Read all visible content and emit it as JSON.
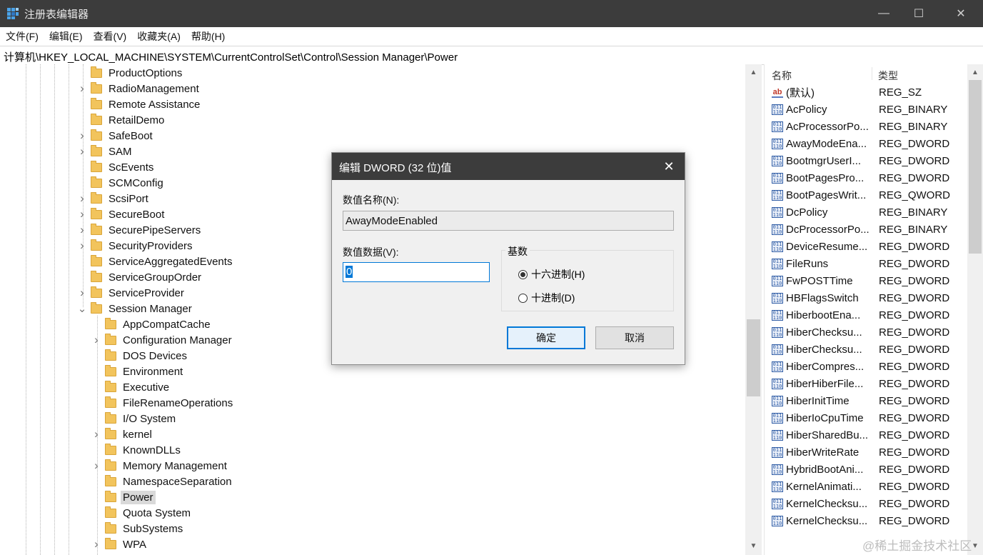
{
  "window": {
    "title": "注册表编辑器",
    "minimize": "—",
    "maximize": "☐",
    "close": "✕"
  },
  "menu": [
    "文件(F)",
    "编辑(E)",
    "查看(V)",
    "收藏夹(A)",
    "帮助(H)"
  ],
  "address": "计算机\\HKEY_LOCAL_MACHINE\\SYSTEM\\CurrentControlSet\\Control\\Session Manager\\Power",
  "tree": {
    "items": [
      {
        "label": "ProductOptions",
        "level": 1,
        "expander": ""
      },
      {
        "label": "RadioManagement",
        "level": 1,
        "expander": "collapsed"
      },
      {
        "label": "Remote Assistance",
        "level": 1,
        "expander": ""
      },
      {
        "label": "RetailDemo",
        "level": 1,
        "expander": ""
      },
      {
        "label": "SafeBoot",
        "level": 1,
        "expander": "collapsed"
      },
      {
        "label": "SAM",
        "level": 1,
        "expander": "collapsed"
      },
      {
        "label": "ScEvents",
        "level": 1,
        "expander": ""
      },
      {
        "label": "SCMConfig",
        "level": 1,
        "expander": ""
      },
      {
        "label": "ScsiPort",
        "level": 1,
        "expander": "collapsed"
      },
      {
        "label": "SecureBoot",
        "level": 1,
        "expander": "collapsed"
      },
      {
        "label": "SecurePipeServers",
        "level": 1,
        "expander": "collapsed"
      },
      {
        "label": "SecurityProviders",
        "level": 1,
        "expander": "collapsed"
      },
      {
        "label": "ServiceAggregatedEvents",
        "level": 1,
        "expander": ""
      },
      {
        "label": "ServiceGroupOrder",
        "level": 1,
        "expander": ""
      },
      {
        "label": "ServiceProvider",
        "level": 1,
        "expander": "collapsed"
      },
      {
        "label": "Session Manager",
        "level": 1,
        "expander": "expanded"
      },
      {
        "label": "AppCompatCache",
        "level": 2,
        "expander": ""
      },
      {
        "label": "Configuration Manager",
        "level": 2,
        "expander": "collapsed"
      },
      {
        "label": "DOS Devices",
        "level": 2,
        "expander": ""
      },
      {
        "label": "Environment",
        "level": 2,
        "expander": ""
      },
      {
        "label": "Executive",
        "level": 2,
        "expander": ""
      },
      {
        "label": "FileRenameOperations",
        "level": 2,
        "expander": ""
      },
      {
        "label": "I/O System",
        "level": 2,
        "expander": ""
      },
      {
        "label": "kernel",
        "level": 2,
        "expander": "collapsed"
      },
      {
        "label": "KnownDLLs",
        "level": 2,
        "expander": ""
      },
      {
        "label": "Memory Management",
        "level": 2,
        "expander": "collapsed"
      },
      {
        "label": "NamespaceSeparation",
        "level": 2,
        "expander": ""
      },
      {
        "label": "Power",
        "level": 2,
        "expander": "",
        "selected": true
      },
      {
        "label": "Quota System",
        "level": 2,
        "expander": ""
      },
      {
        "label": "SubSystems",
        "level": 2,
        "expander": ""
      },
      {
        "label": "WPA",
        "level": 2,
        "expander": "collapsed"
      }
    ]
  },
  "list": {
    "header": {
      "name": "名称",
      "type": "类型"
    },
    "rows": [
      {
        "icon": "string-value-icon",
        "name": "(默认)",
        "type": "REG_SZ"
      },
      {
        "icon": "binary-value-icon",
        "name": "AcPolicy",
        "type": "REG_BINARY"
      },
      {
        "icon": "binary-value-icon",
        "name": "AcProcessorPo...",
        "type": "REG_BINARY"
      },
      {
        "icon": "binary-value-icon",
        "name": "AwayModeEna...",
        "type": "REG_DWORD"
      },
      {
        "icon": "binary-value-icon",
        "name": "BootmgrUserI...",
        "type": "REG_DWORD"
      },
      {
        "icon": "binary-value-icon",
        "name": "BootPagesPro...",
        "type": "REG_DWORD"
      },
      {
        "icon": "binary-value-icon",
        "name": "BootPagesWrit...",
        "type": "REG_QWORD"
      },
      {
        "icon": "binary-value-icon",
        "name": "DcPolicy",
        "type": "REG_BINARY"
      },
      {
        "icon": "binary-value-icon",
        "name": "DcProcessorPo...",
        "type": "REG_BINARY"
      },
      {
        "icon": "binary-value-icon",
        "name": "DeviceResume...",
        "type": "REG_DWORD"
      },
      {
        "icon": "binary-value-icon",
        "name": "FileRuns",
        "type": "REG_DWORD"
      },
      {
        "icon": "binary-value-icon",
        "name": "FwPOSTTime",
        "type": "REG_DWORD"
      },
      {
        "icon": "binary-value-icon",
        "name": "HBFlagsSwitch",
        "type": "REG_DWORD"
      },
      {
        "icon": "binary-value-icon",
        "name": "HiberbootEna...",
        "type": "REG_DWORD"
      },
      {
        "icon": "binary-value-icon",
        "name": "HiberChecksu...",
        "type": "REG_DWORD"
      },
      {
        "icon": "binary-value-icon",
        "name": "HiberChecksu...",
        "type": "REG_DWORD"
      },
      {
        "icon": "binary-value-icon",
        "name": "HiberCompres...",
        "type": "REG_DWORD"
      },
      {
        "icon": "binary-value-icon",
        "name": "HiberHiberFile...",
        "type": "REG_DWORD"
      },
      {
        "icon": "binary-value-icon",
        "name": "HiberInitTime",
        "type": "REG_DWORD"
      },
      {
        "icon": "binary-value-icon",
        "name": "HiberIoCpuTime",
        "type": "REG_DWORD"
      },
      {
        "icon": "binary-value-icon",
        "name": "HiberSharedBu...",
        "type": "REG_DWORD"
      },
      {
        "icon": "binary-value-icon",
        "name": "HiberWriteRate",
        "type": "REG_DWORD"
      },
      {
        "icon": "binary-value-icon",
        "name": "HybridBootAni...",
        "type": "REG_DWORD"
      },
      {
        "icon": "binary-value-icon",
        "name": "KernelAnimati...",
        "type": "REG_DWORD"
      },
      {
        "icon": "binary-value-icon",
        "name": "KernelChecksu...",
        "type": "REG_DWORD"
      },
      {
        "icon": "binary-value-icon",
        "name": "KernelChecksu...",
        "type": "REG_DWORD"
      }
    ]
  },
  "dialog": {
    "title": "编辑 DWORD (32 位)值",
    "close": "✕",
    "name_label": "数值名称(N):",
    "name_value": "AwayModeEnabled",
    "data_label": "数值数据(V):",
    "data_value": "0",
    "base_label": "基数",
    "radio_hex": "十六进制(H)",
    "radio_dec": "十进制(D)",
    "selected_base": "hex",
    "ok": "确定",
    "cancel": "取消"
  },
  "watermark": "@稀土掘金技术社区",
  "colors": {
    "titlebar": "#3c3c3c",
    "accent": "#0078d7",
    "folder": "#f2c45c"
  }
}
